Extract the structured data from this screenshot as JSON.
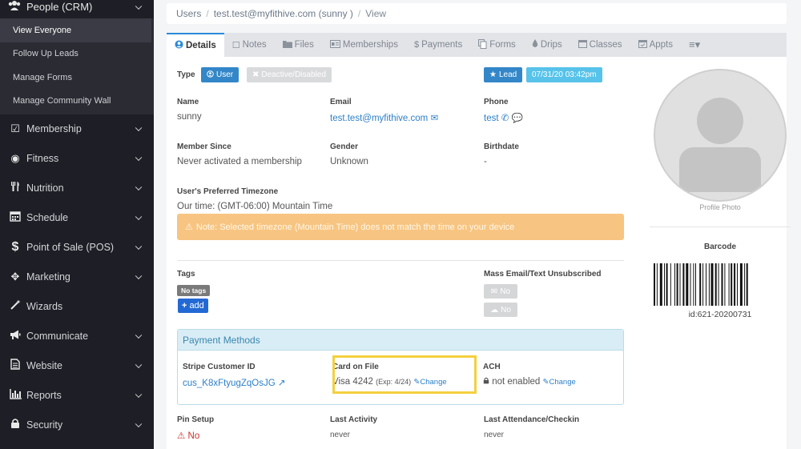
{
  "sidebar": {
    "top": {
      "label": "People (CRM)",
      "icon": "people-icon"
    },
    "sub_items": [
      {
        "label": "View Everyone",
        "active": true
      },
      {
        "label": "Follow Up Leads"
      },
      {
        "label": "Manage Forms"
      },
      {
        "label": "Manage Community Wall"
      }
    ],
    "items": [
      {
        "label": "Membership",
        "icon": "check-square-icon"
      },
      {
        "label": "Fitness",
        "icon": "compass-icon"
      },
      {
        "label": "Nutrition",
        "icon": "utensils-icon"
      },
      {
        "label": "Schedule",
        "icon": "calendar-icon"
      },
      {
        "label": "Point of Sale (POS)",
        "icon": "dollar-icon"
      },
      {
        "label": "Marketing",
        "icon": "arrows-icon"
      },
      {
        "label": "Wizards",
        "icon": "magic-wand-icon"
      },
      {
        "label": "Communicate",
        "icon": "megaphone-icon"
      },
      {
        "label": "Website",
        "icon": "file-icon"
      },
      {
        "label": "Reports",
        "icon": "bar-chart-icon"
      },
      {
        "label": "Security",
        "icon": "lock-icon"
      }
    ]
  },
  "breadcrumb": [
    "Users",
    "test.test@myfithive.com (sunny )",
    "View"
  ],
  "tabs": [
    {
      "label": "Details",
      "icon": "user-circle-icon",
      "active": true
    },
    {
      "label": "Notes",
      "icon": "note-icon"
    },
    {
      "label": "Files",
      "icon": "folder-icon"
    },
    {
      "label": "Memberships",
      "icon": "id-card-icon"
    },
    {
      "label": "Payments",
      "icon": "dollar-icon"
    },
    {
      "label": "Forms",
      "icon": "copy-icon"
    },
    {
      "label": "Drips",
      "icon": "drop-icon"
    },
    {
      "label": "Classes",
      "icon": "calendar-icon"
    },
    {
      "label": "Appts",
      "icon": "calendar-check-icon"
    },
    {
      "label": "",
      "icon": "menu-icon"
    }
  ],
  "details": {
    "type_label": "Type",
    "user_btn": "User",
    "deact_btn": "Deactive/Disabled",
    "lead_btn": "Lead",
    "date_badge": "07/31/20 03:42pm",
    "name_label": "Name",
    "name_value": "sunny",
    "email_label": "Email",
    "email_value": "test.test@myfithive.com",
    "phone_label": "Phone",
    "phone_value": "test",
    "member_since_label": "Member Since",
    "member_since_value": "Never activated a membership",
    "gender_label": "Gender",
    "gender_value": "Unknown",
    "birthdate_label": "Birthdate",
    "birthdate_value": "-",
    "timezone_label": "User's Preferred Timezone",
    "timezone_value": "Our time: (GMT-06:00) Mountain Time",
    "warning": "Note: Selected timezone (Mountain Time) does not match the time on your device",
    "tags_label": "Tags",
    "no_tags": "No tags",
    "add_btn": "add",
    "mass_label": "Mass Email/Text Unsubscribed",
    "email_unsub": "No",
    "text_unsub": "No"
  },
  "payment": {
    "title": "Payment Methods",
    "stripe_label": "Stripe Customer ID",
    "stripe_value": "cus_K8xFtyugZqOsJG",
    "card_label": "Card on File",
    "card_value": "Visa 4242",
    "card_exp": "(Exp: 4/24)",
    "card_change": "Change",
    "ach_label": "ACH",
    "ach_value": "not enabled",
    "ach_change": "Change"
  },
  "footer": {
    "pin_label": "Pin Setup",
    "pin_value": "No",
    "activity_label": "Last Activity",
    "activity_value": "never",
    "attendance_label": "Last Attendance/Checkin",
    "attendance_value": "never"
  },
  "profile": {
    "photo_label": "Profile Photo",
    "barcode_title": "Barcode",
    "barcode_id": "id:621-20200731"
  },
  "colors": {
    "sidebar_bg": "#1e1f26",
    "accent": "#3387c8",
    "warning": "#f7c581",
    "highlight": "#f4d03f"
  }
}
